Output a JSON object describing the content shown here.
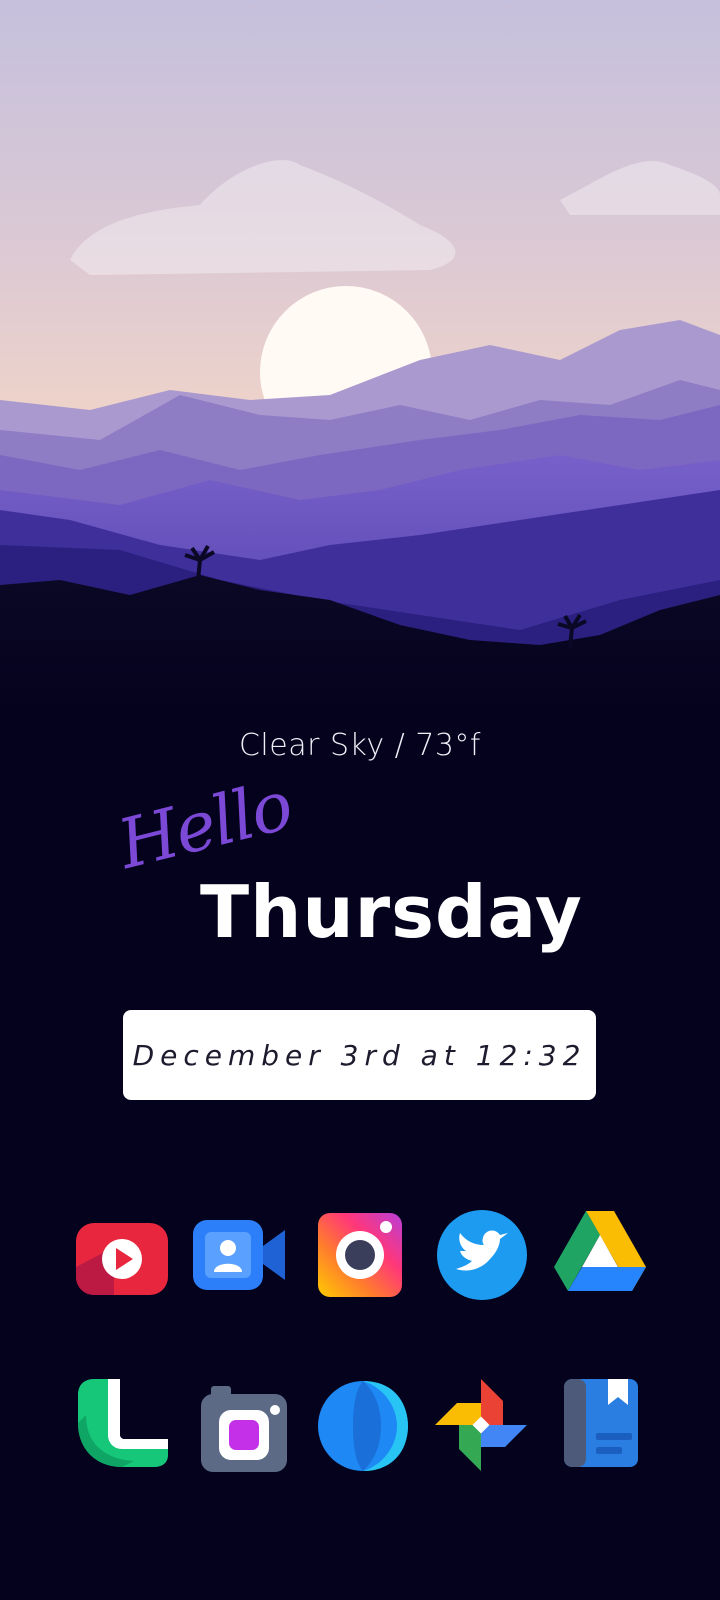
{
  "widget": {
    "weather": "Clear Sky / 73°f",
    "greeting": "Hello",
    "day": "Thursday",
    "date_time": "December 3rd at 12:32"
  },
  "apps": {
    "row1": [
      {
        "icon": "video-player-icon",
        "color": "#e8273e"
      },
      {
        "icon": "video-call-icon",
        "color": "#2d7ff9"
      },
      {
        "icon": "camera-gallery-icon",
        "color": "#ff4f7b"
      },
      {
        "icon": "twitter-bird-icon",
        "color": "#1d9bf0"
      },
      {
        "icon": "drive-triangle-icon",
        "color": "#1fa463"
      }
    ],
    "row2": [
      {
        "icon": "phone-icon",
        "color": "#16c77a"
      },
      {
        "icon": "camera-icon",
        "color": "#5d6a86"
      },
      {
        "icon": "browser-globe-icon",
        "color": "#1e88f5"
      },
      {
        "icon": "pinwheel-photos-icon",
        "color": "#fbbc04"
      },
      {
        "icon": "notebook-icon",
        "color": "#2a7de1"
      }
    ]
  }
}
